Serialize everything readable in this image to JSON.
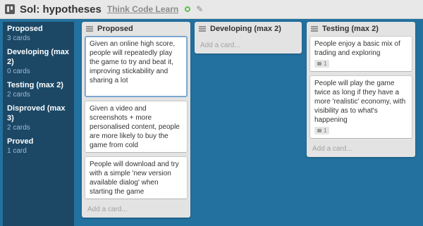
{
  "header": {
    "title": "Sol: hypotheses",
    "org": "Think Code Learn"
  },
  "sidebar": {
    "items": [
      {
        "name": "Proposed",
        "count": "3 cards"
      },
      {
        "name": "Developing (max 2)",
        "count": "0 cards"
      },
      {
        "name": "Testing (max 2)",
        "count": "2 cards"
      },
      {
        "name": "Disproved (max 3)",
        "count": "2 cards"
      },
      {
        "name": "Proved",
        "count": "1 card"
      }
    ]
  },
  "lists": [
    {
      "title": "Proposed",
      "add_label": "Add a card...",
      "cards": [
        {
          "text": "Given an online high score, people will repeatedly play the game to try and beat it, improving stickability and sharing a lot"
        },
        {
          "text": "Given a video and screenshots + more personalised content, people are more likely to buy the game from cold"
        },
        {
          "text": "People will download and try with a simple 'new version available dialog' when starting the game"
        }
      ]
    },
    {
      "title": "Developing (max 2)",
      "add_label": "Add a card...",
      "cards": []
    },
    {
      "title": "Testing (max 2)",
      "add_label": "Add a card...",
      "cards": [
        {
          "text": "People enjoy a basic mix of trading and exploring",
          "comments": "1"
        },
        {
          "text": "People will play the game twice as long if they have a more 'realistic' economy, with visibility as to what's happening",
          "comments": "1"
        }
      ]
    }
  ]
}
